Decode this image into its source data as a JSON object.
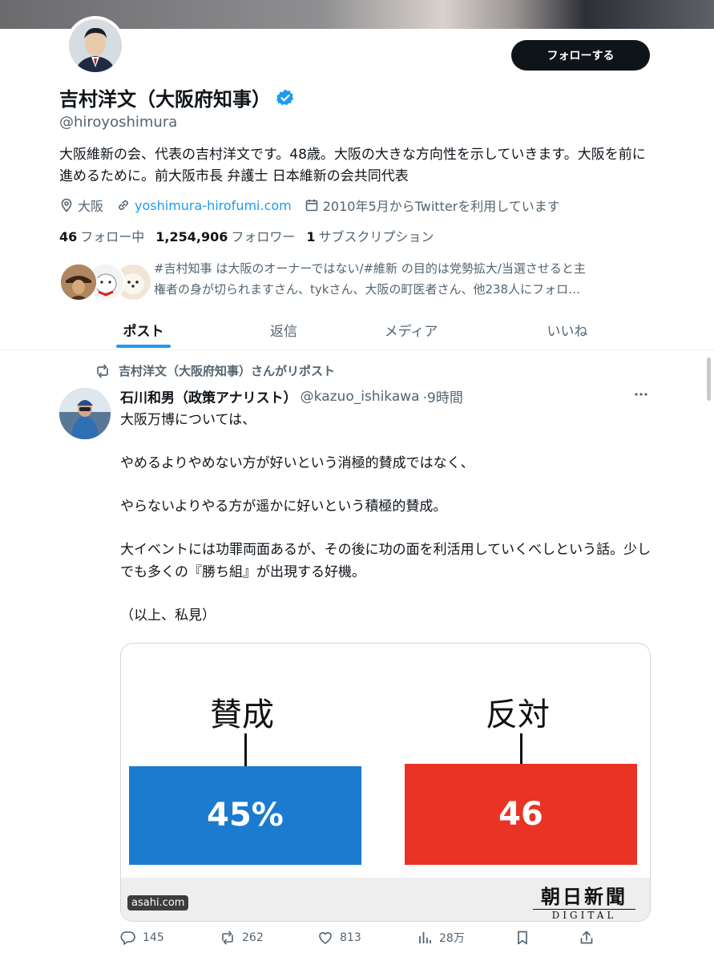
{
  "profile": {
    "display_name": "吉村洋文（大阪府知事）",
    "handle": "@hiroyoshimura",
    "follow_button": "フォローする",
    "bio": "大阪維新の会、代表の吉村洋文です。48歳。大阪の大きな方向性を示していきます。大阪を前に進めるために。前大阪市長 弁護士 日本維新の会共同代表",
    "location": "大阪",
    "website": "yoshimura-hirofumi.com",
    "joined": "2010年5月からTwitterを利用しています",
    "following_count": "46",
    "following_label": "フォロー中",
    "followers_count": "1,254,906",
    "followers_label": "フォロワー",
    "subscriptions_count": "1",
    "subscriptions_label": "サブスクリプション",
    "known_followers_line1": "#吉村知事 は大阪のオーナーではない/#維新 の目的は党勢拡大/当選させると主",
    "known_followers_line2": "権者の身が切られますさん、tykさん、大阪の町医者さん、他238人にフォロ…"
  },
  "tabs": [
    {
      "label": "ポスト"
    },
    {
      "label": "返信"
    },
    {
      "label": "メディア"
    },
    {
      "label": "いいね"
    }
  ],
  "post": {
    "repost_label": "吉村洋文（大阪府知事）さんがリポスト",
    "author_name": "石川和男（政策アナリスト）",
    "author_handle": "@kazuo_ishikawa",
    "time": "·9時間",
    "paragraphs": [
      "大阪万博については、",
      "やめるよりやめない方が好いという消極的賛成ではなく、",
      "やらないよりやる方が遥かに好いという積極的賛成。",
      "大イベントには功罪両面あるが、その後に功の面を利活用していくべしという話。少しでも多くの『勝ち組』が出現する好機。",
      "（以上、私見）"
    ],
    "card": {
      "domain": "asahi.com",
      "brand_line1": "朝日新聞",
      "brand_line2": "DIGITAL"
    },
    "actions": {
      "replies": "145",
      "reposts": "262",
      "likes": "813",
      "views": "28万"
    }
  },
  "chart_data": {
    "type": "bar",
    "categories": [
      "賛成",
      "反対"
    ],
    "values": [
      45,
      46
    ],
    "data_labels": [
      "45%",
      "46"
    ],
    "colors": [
      "#1b7bcf",
      "#e83325"
    ]
  },
  "colors": {
    "accent": "#1d9bf0",
    "verified": "#1d9bf0",
    "text_primary": "#0f1419",
    "text_secondary": "#536471"
  }
}
